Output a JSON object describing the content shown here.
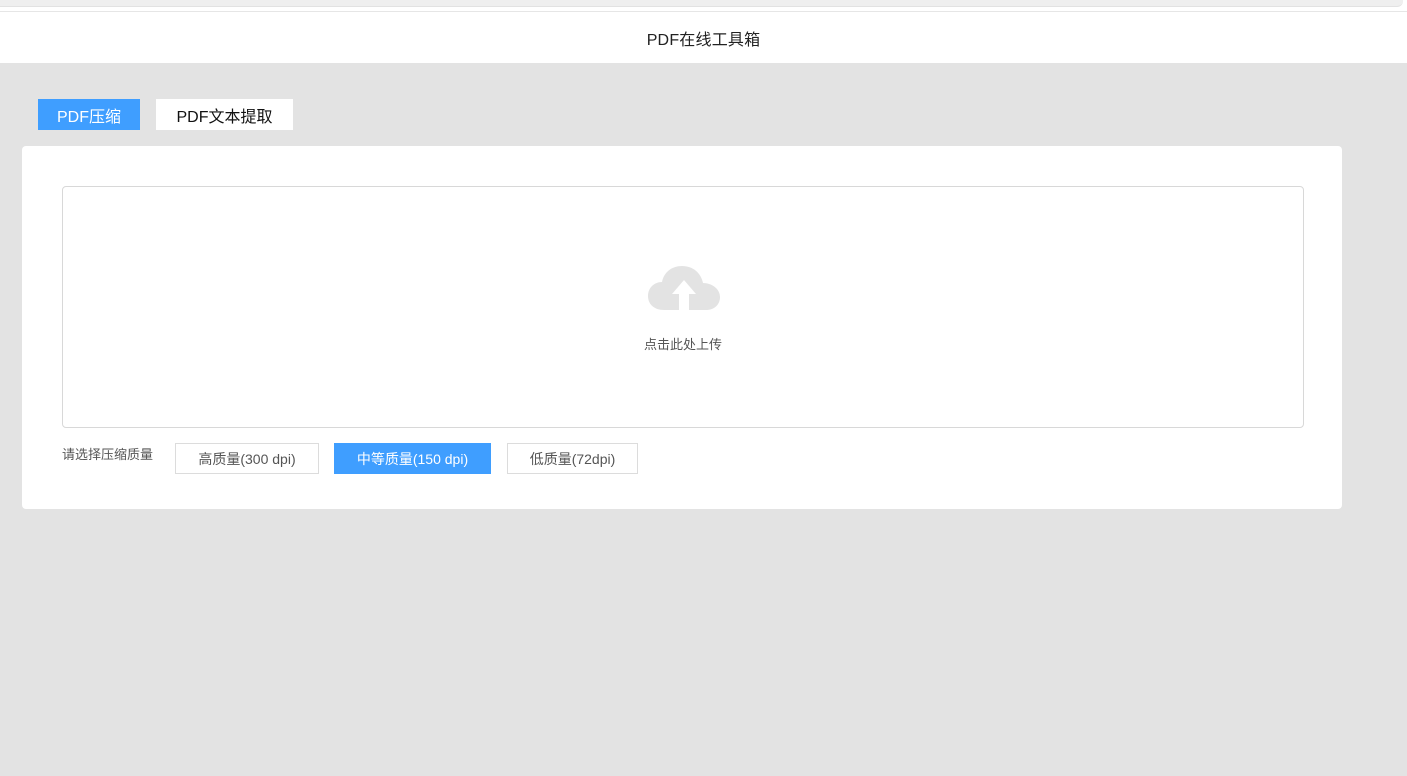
{
  "header": {
    "title": "PDF在线工具箱"
  },
  "tabs": [
    {
      "label": "PDF压缩",
      "active": true
    },
    {
      "label": "PDF文本提取",
      "active": false
    }
  ],
  "upload": {
    "icon": "cloud-upload-icon",
    "text": "点击此处上传"
  },
  "quality": {
    "label": "请选择压缩质量",
    "options": [
      {
        "label": "高质量(300 dpi)",
        "selected": false
      },
      {
        "label": "中等质量(150 dpi)",
        "selected": true
      },
      {
        "label": "低质量(72dpi)",
        "selected": false
      }
    ]
  },
  "colors": {
    "accent": "#3f9eff",
    "background": "#e3e3e3",
    "card": "#ffffff",
    "icon": "#e2e2e2"
  }
}
